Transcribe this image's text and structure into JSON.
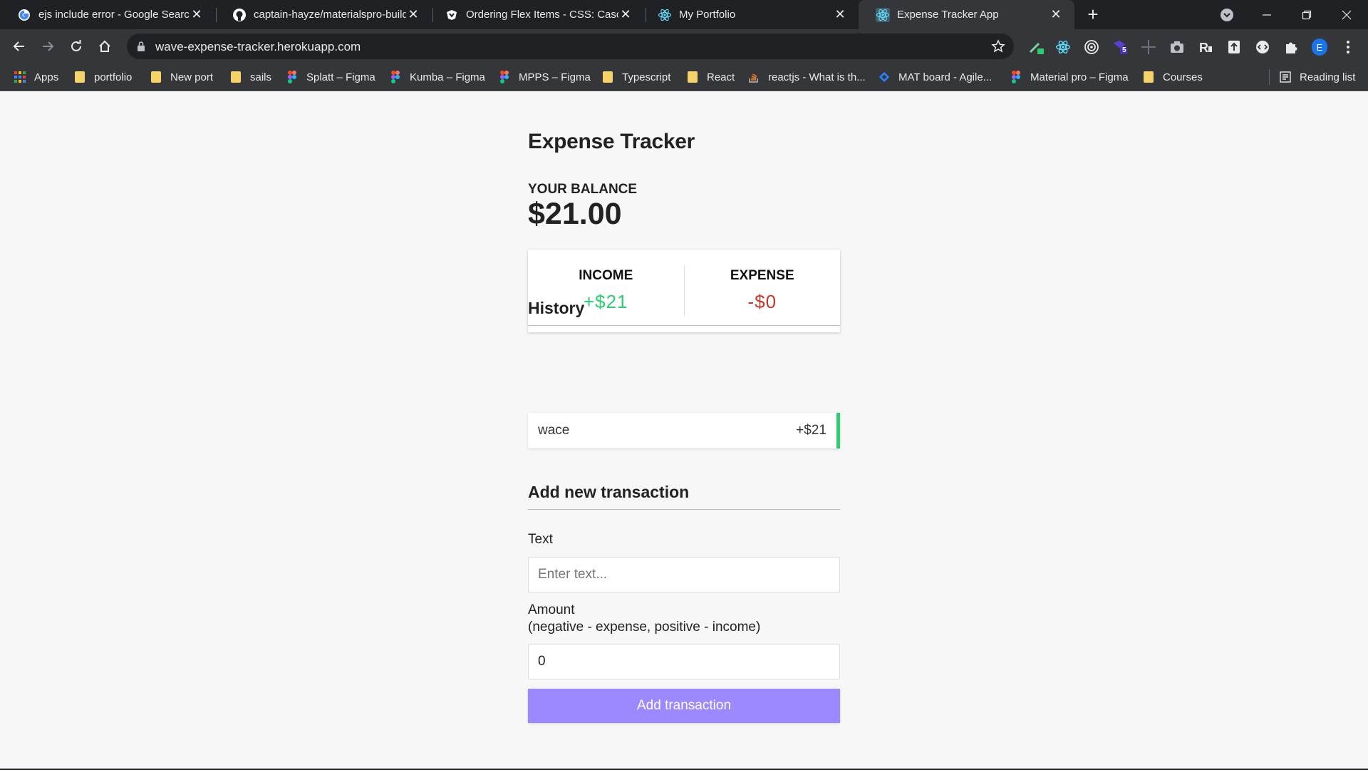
{
  "browser": {
    "tabs": [
      {
        "title": "ejs include error - Google Search",
        "icon": "google-icon"
      },
      {
        "title": "captain-hayze/materialspro-build",
        "icon": "github-icon"
      },
      {
        "title": "Ordering Flex Items - CSS: Cascad",
        "icon": "mdn-icon"
      },
      {
        "title": "My Portfolio",
        "icon": "react-icon"
      },
      {
        "title": "Expense Tracker App",
        "icon": "react-icon",
        "active": true
      }
    ],
    "url": "wave-expense-tracker.herokuapp.com",
    "profile_initial": "E",
    "extension_badge": "5",
    "bookmarks": [
      {
        "label": "Apps",
        "icon": "apps-grid-icon"
      },
      {
        "label": "portfolio",
        "icon": "folder-icon"
      },
      {
        "label": "New port",
        "icon": "folder-icon"
      },
      {
        "label": "sails",
        "icon": "folder-icon"
      },
      {
        "label": "Splatt – Figma",
        "icon": "figma-icon"
      },
      {
        "label": "Kumba – Figma",
        "icon": "figma-icon"
      },
      {
        "label": "MPPS – Figma",
        "icon": "figma-icon"
      },
      {
        "label": "Typescript",
        "icon": "folder-icon"
      },
      {
        "label": "React",
        "icon": "folder-icon"
      },
      {
        "label": "reactjs - What is th...",
        "icon": "stackoverflow-icon"
      },
      {
        "label": "MAT board - Agile...",
        "icon": "jira-icon"
      },
      {
        "label": "Material pro – Figma",
        "icon": "figma-icon"
      },
      {
        "label": "Courses",
        "icon": "folder-icon"
      }
    ],
    "reading_list": "Reading list"
  },
  "app": {
    "title": "Expense Tracker",
    "balance_label": "YOUR BALANCE",
    "balance": "$21.00",
    "income_label": "INCOME",
    "income": "+$21",
    "expense_label": "EXPENSE",
    "expense": "-$0",
    "history_title": "History",
    "history": [
      {
        "text": "wace",
        "amount": "+$21",
        "type": "plus"
      }
    ],
    "add_title": "Add new transaction",
    "text_label": "Text",
    "text_placeholder": "Enter text...",
    "amount_label": "Amount",
    "amount_hint": "(negative - expense, positive - income)",
    "amount_value": "0",
    "submit_label": "Add transaction"
  },
  "colors": {
    "income": "#2ecc71",
    "expense": "#c0392b",
    "button": "#9c88ff",
    "chrome_dark": "#202124",
    "chrome_toolbar": "#35363a"
  }
}
